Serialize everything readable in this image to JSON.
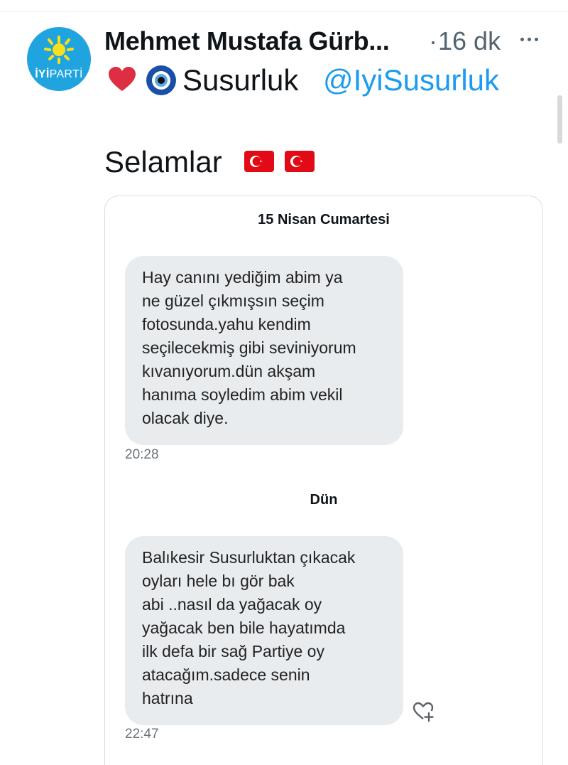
{
  "tweet": {
    "author_name": "Mehmet Mustafa Gürb...",
    "separator": "·",
    "time_ago": "16 dk",
    "location_text": "Susurluk",
    "handle": "@IyiSusurluk",
    "text": "Selamlar",
    "avatar": {
      "logo_bold": "İYİ",
      "logo_thin": "PARTİ",
      "color": "#1fa4e0"
    },
    "icons": [
      "heart-icon",
      "nazar-eye-icon",
      "turkish-flag-icon",
      "more-icon"
    ],
    "handle_color": "#1d9bf0"
  },
  "chat": {
    "groups": [
      {
        "date_label": "15 Nisan Cumartesi",
        "message_lines": [
          "Hay canını yediğim abim ya",
          "ne güzel çıkmışsın seçim",
          "fotosunda.yahu kendim",
          "seçilecekmiş gibi seviniyorum",
          "kıvanıyorum.dün akşam",
          "hanıma soyledim abim vekil",
          "olacak diye."
        ],
        "time": "20:28"
      },
      {
        "date_label": "Dün",
        "message_lines": [
          "Balıkesir Susurluktan çıkacak",
          "oyları hele bı gör bak",
          "abi ..nasıl da yağacak oy",
          "yağacak ben bile hayatımda",
          "ilk defa bir sağ Partiye oy",
          "atacağım.sadece senin",
          "hatrına"
        ],
        "time": "22:47"
      }
    ],
    "bubble_color": "#e9ecef"
  }
}
